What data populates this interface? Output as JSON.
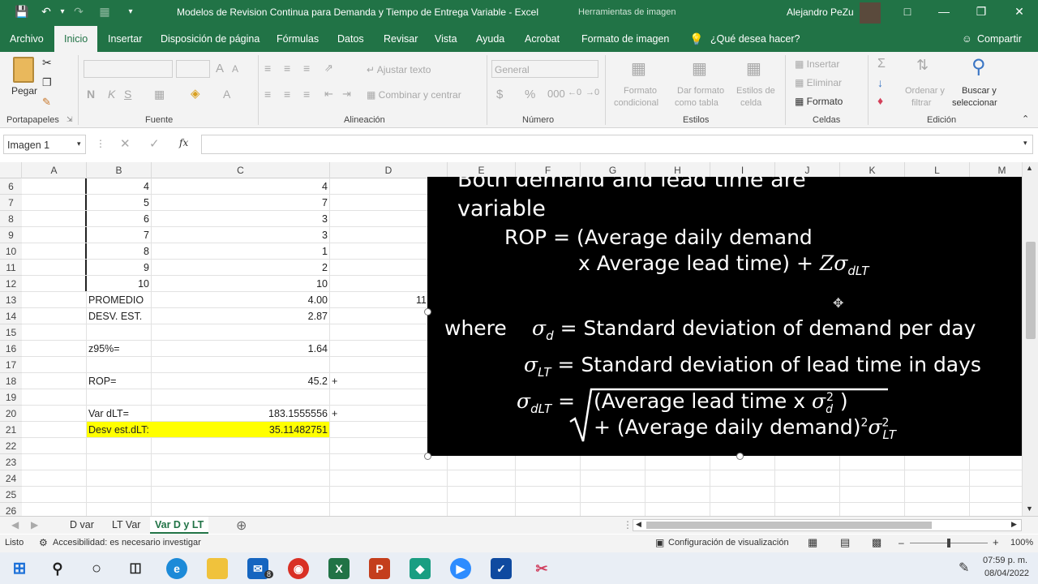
{
  "titlebar": {
    "doc_title": "Modelos de Revision Continua para Demanda y Tiempo de Entrega Variable  -  Excel",
    "context_tool": "Herramientas de imagen",
    "user": "Alejandro PeZu"
  },
  "tabs": [
    "Archivo",
    "Inicio",
    "Insertar",
    "Disposición de página",
    "Fórmulas",
    "Datos",
    "Revisar",
    "Vista",
    "Ayuda",
    "Acrobat",
    "Formato de imagen"
  ],
  "tell_me": "¿Qué desea hacer?",
  "share": "Compartir",
  "ribbon": {
    "paste": "Pegar",
    "groups": [
      "Portapapeles",
      "Fuente",
      "Alineación",
      "Número",
      "Estilos",
      "Celdas",
      "Edición"
    ],
    "bold": "N",
    "italic": "K",
    "underline": "S",
    "wrap_text": "Ajustar texto",
    "merge": "Combinar y centrar",
    "number_format": "General",
    "cond_format": [
      "Formato",
      "condicional"
    ],
    "table_format": [
      "Dar formato",
      "como tabla"
    ],
    "cell_styles": [
      "Estilos de",
      "celda"
    ],
    "insert": "Insertar",
    "delete": "Eliminar",
    "format": "Formato",
    "sort": [
      "Ordenar y",
      "filtrar"
    ],
    "find": [
      "Buscar y",
      "seleccionar"
    ]
  },
  "namebox": "Imagen 1",
  "fx": "fx",
  "columns": [
    "A",
    "B",
    "C",
    "D",
    "E",
    "F",
    "G",
    "H",
    "I",
    "J",
    "K",
    "L",
    "M"
  ],
  "rows": [
    {
      "n": "6",
      "b": "4",
      "c": "4"
    },
    {
      "n": "7",
      "b": "5",
      "c": "7"
    },
    {
      "n": "8",
      "b": "6",
      "c": "3"
    },
    {
      "n": "9",
      "b": "7",
      "c": "3"
    },
    {
      "n": "10",
      "b": "8",
      "c": "1"
    },
    {
      "n": "11",
      "b": "9",
      "c": "2"
    },
    {
      "n": "12",
      "b": "10",
      "c": "10"
    },
    {
      "n": "13",
      "b": "PROMEDIO",
      "c": "4.00",
      "d": "11"
    },
    {
      "n": "14",
      "b": "DESV. EST.",
      "c": "2.87"
    },
    {
      "n": "15",
      "b": "",
      "c": ""
    },
    {
      "n": "16",
      "b": "z95%=",
      "c": "1.64"
    },
    {
      "n": "17",
      "b": "",
      "c": ""
    },
    {
      "n": "18",
      "b": "ROP=",
      "c": "45.2",
      "d": "+"
    },
    {
      "n": "19",
      "b": "",
      "c": ""
    },
    {
      "n": "20",
      "b": "Var dLT=",
      "c": "183.1555556",
      "d": "+"
    },
    {
      "n": "21",
      "b": "Desv est.dLT:",
      "c": "35.11482751"
    },
    {
      "n": "22",
      "b": "",
      "c": ""
    },
    {
      "n": "23",
      "b": "",
      "c": ""
    },
    {
      "n": "24",
      "b": "",
      "c": ""
    },
    {
      "n": "25",
      "b": "",
      "c": ""
    },
    {
      "n": "26",
      "b": "",
      "c": ""
    }
  ],
  "picture": {
    "line1": "Both demand and lead time are",
    "line2": "variable",
    "rop_a": "ROP =  (Average daily demand",
    "rop_b": "x Average lead time) +",
    "z": "Z",
    "sigma": "σ",
    "sub_dlt": "dLT",
    "sub_d": "d",
    "sub_lt": "LT",
    "where": "where",
    "def_d": "= Standard deviation of demand per day",
    "def_lt": "= Standard deviation of lead time in days",
    "eq": "=",
    "sq1": "(Average lead time x",
    "sq1_end": ")",
    "sq2": "+ (Average daily demand)",
    "sup2": "2"
  },
  "sheets": [
    "D var",
    "LT Var",
    "Var D y LT"
  ],
  "active_sheet": "Var D y LT",
  "status": {
    "ready": "Listo",
    "accessibility": "Accesibilidad: es necesario investigar",
    "display": "Configuración de visualización",
    "zoom": "100%"
  },
  "taskbar": {
    "time": "07:59 p. m.",
    "date": "08/04/2022",
    "mail_badge": "8"
  },
  "colors": {
    "excel_green": "#217346",
    "highlight": "#ffff00"
  }
}
